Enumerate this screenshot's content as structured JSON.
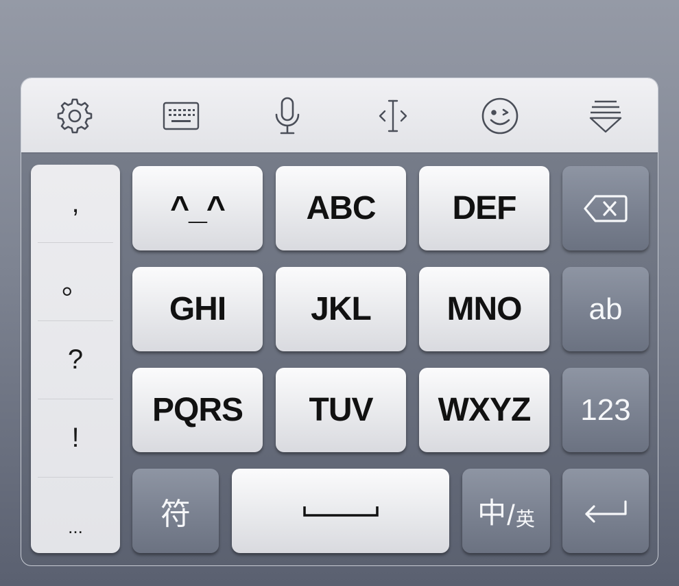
{
  "toolbar": {
    "icons": [
      "gear-icon",
      "keyboard-icon",
      "microphone-icon",
      "text-cursor-icon",
      "emoji-icon",
      "hide-keyboard-icon"
    ]
  },
  "punctuation": [
    ",",
    "。",
    "?",
    "!",
    "..."
  ],
  "keys": {
    "row1": [
      "^_^",
      "ABC",
      "DEF"
    ],
    "row2": [
      "GHI",
      "JKL",
      "MNO"
    ],
    "row3": [
      "PQRS",
      "TUV",
      "WXYZ"
    ],
    "symbols": "符",
    "ab": "ab",
    "num": "123",
    "lang_main": "中",
    "lang_slash": "/",
    "lang_secondary": "英"
  },
  "colors": {
    "light_key": "#e8e9ec",
    "dark_key": "#7a8190",
    "background": "#7e8492",
    "icon_stroke": "#4a4e58"
  }
}
